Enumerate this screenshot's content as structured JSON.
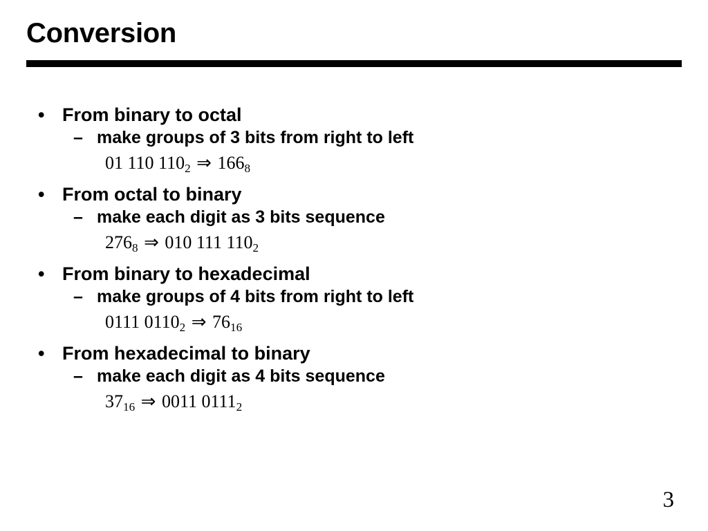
{
  "slide": {
    "title": "Conversion",
    "page_number": "3",
    "accent_color": "#000000",
    "background_color": "#ffffff",
    "bullet_marker": "•",
    "dash_marker": "–",
    "arrow_symbol": "⇒",
    "blocks": [
      {
        "heading": "From binary to octal",
        "rule": "make groups of 3 bits from right to left",
        "formula": {
          "left_value": "01 110 110",
          "left_base": "2",
          "right_value": "166",
          "right_base": "8"
        }
      },
      {
        "heading": "From octal to binary",
        "rule": "make each digit as 3 bits sequence",
        "formula": {
          "left_value": "276",
          "left_base": "8",
          "right_value": "010 111 110",
          "right_base": "2"
        }
      },
      {
        "heading": "From binary to hexadecimal",
        "rule": "make groups of 4 bits from right to left",
        "formula": {
          "left_value": "0111 0110",
          "left_base": "2",
          "right_value": "76",
          "right_base": "16"
        }
      },
      {
        "heading": "From hexadecimal to binary",
        "rule": "make each digit as 4 bits sequence",
        "formula": {
          "left_value": "37",
          "left_base": "16",
          "right_value": "0011 0111",
          "right_base": "2"
        }
      }
    ]
  }
}
